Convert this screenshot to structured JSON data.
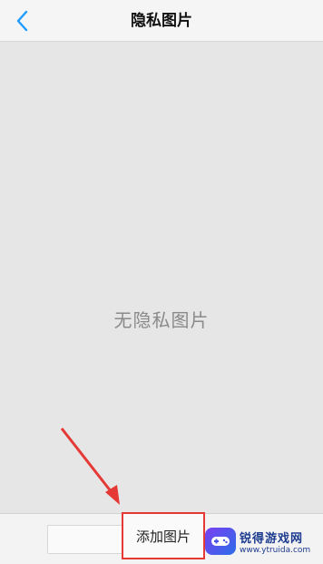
{
  "header": {
    "title": "隐私图片"
  },
  "main": {
    "empty_text": "无隐私图片"
  },
  "bottom": {
    "add_label": "添加图片"
  },
  "watermark": {
    "name": "锐得游戏网",
    "url": "www.ytruida.com"
  },
  "colors": {
    "accent": "#1e9bff",
    "highlight": "#e53935"
  }
}
